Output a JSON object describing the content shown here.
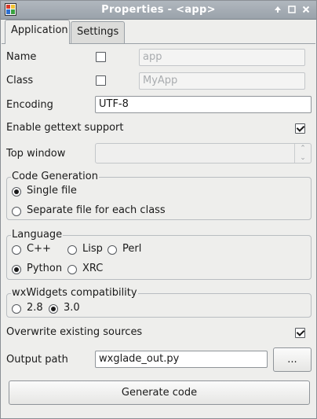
{
  "window": {
    "title": "Properties - <app>",
    "controls": [
      "pin-icon",
      "maximize-icon",
      "close-icon"
    ]
  },
  "tabs": [
    {
      "label": "Application",
      "active": true
    },
    {
      "label": "Settings",
      "active": false
    }
  ],
  "form": {
    "name": {
      "label": "Name",
      "checked": false,
      "value": "app",
      "enabled": false
    },
    "class": {
      "label": "Class",
      "checked": false,
      "value": "MyApp",
      "enabled": false
    },
    "encoding": {
      "label": "Encoding",
      "value": "UTF-8"
    },
    "gettext": {
      "label": "Enable gettext support",
      "checked": true
    },
    "top_window": {
      "label": "Top window",
      "value": "",
      "enabled": false
    }
  },
  "code_generation": {
    "title": "Code Generation",
    "options": [
      {
        "label": "Single file",
        "selected": true
      },
      {
        "label": "Separate file for each class",
        "selected": false
      }
    ]
  },
  "language": {
    "title": "Language",
    "options": [
      {
        "label": "C++",
        "selected": false
      },
      {
        "label": "Lisp",
        "selected": false
      },
      {
        "label": "Perl",
        "selected": false
      },
      {
        "label": "Python",
        "selected": true
      },
      {
        "label": "XRC",
        "selected": false
      }
    ]
  },
  "wx_compat": {
    "title": "wxWidgets compatibility",
    "options": [
      {
        "label": "2.8",
        "selected": false
      },
      {
        "label": "3.0",
        "selected": true
      }
    ]
  },
  "overwrite": {
    "label": "Overwrite existing sources",
    "checked": true
  },
  "output_path": {
    "label": "Output path",
    "value": "wxglade_out.py",
    "browse_label": "..."
  },
  "generate_button": "Generate code",
  "colors": {
    "titlebar": "#9aa2aa",
    "window_bg": "#eeeeec",
    "border": "#8a8f95"
  }
}
